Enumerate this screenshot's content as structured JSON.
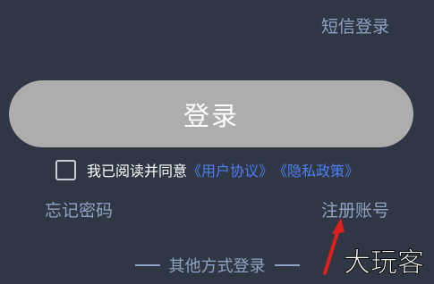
{
  "header": {
    "sms_login_label": "短信登录"
  },
  "login": {
    "button_label": "登录"
  },
  "agreement": {
    "checked": false,
    "prefix_text": "我已阅读并同意",
    "user_agreement_label": "《用户协议》",
    "privacy_policy_label": "《隐私政策》"
  },
  "links": {
    "forgot_password_label": "忘记密码",
    "register_label": "注册账号"
  },
  "other_login": {
    "label": "其他方式登录"
  },
  "watermark": {
    "text": "大玩客"
  },
  "colors": {
    "background": "#2f3744",
    "link_muted": "#8ea3c4",
    "button_disabled": "#adadad",
    "policy_link": "#4f7ef5",
    "annotation_arrow": "#e0201b"
  }
}
